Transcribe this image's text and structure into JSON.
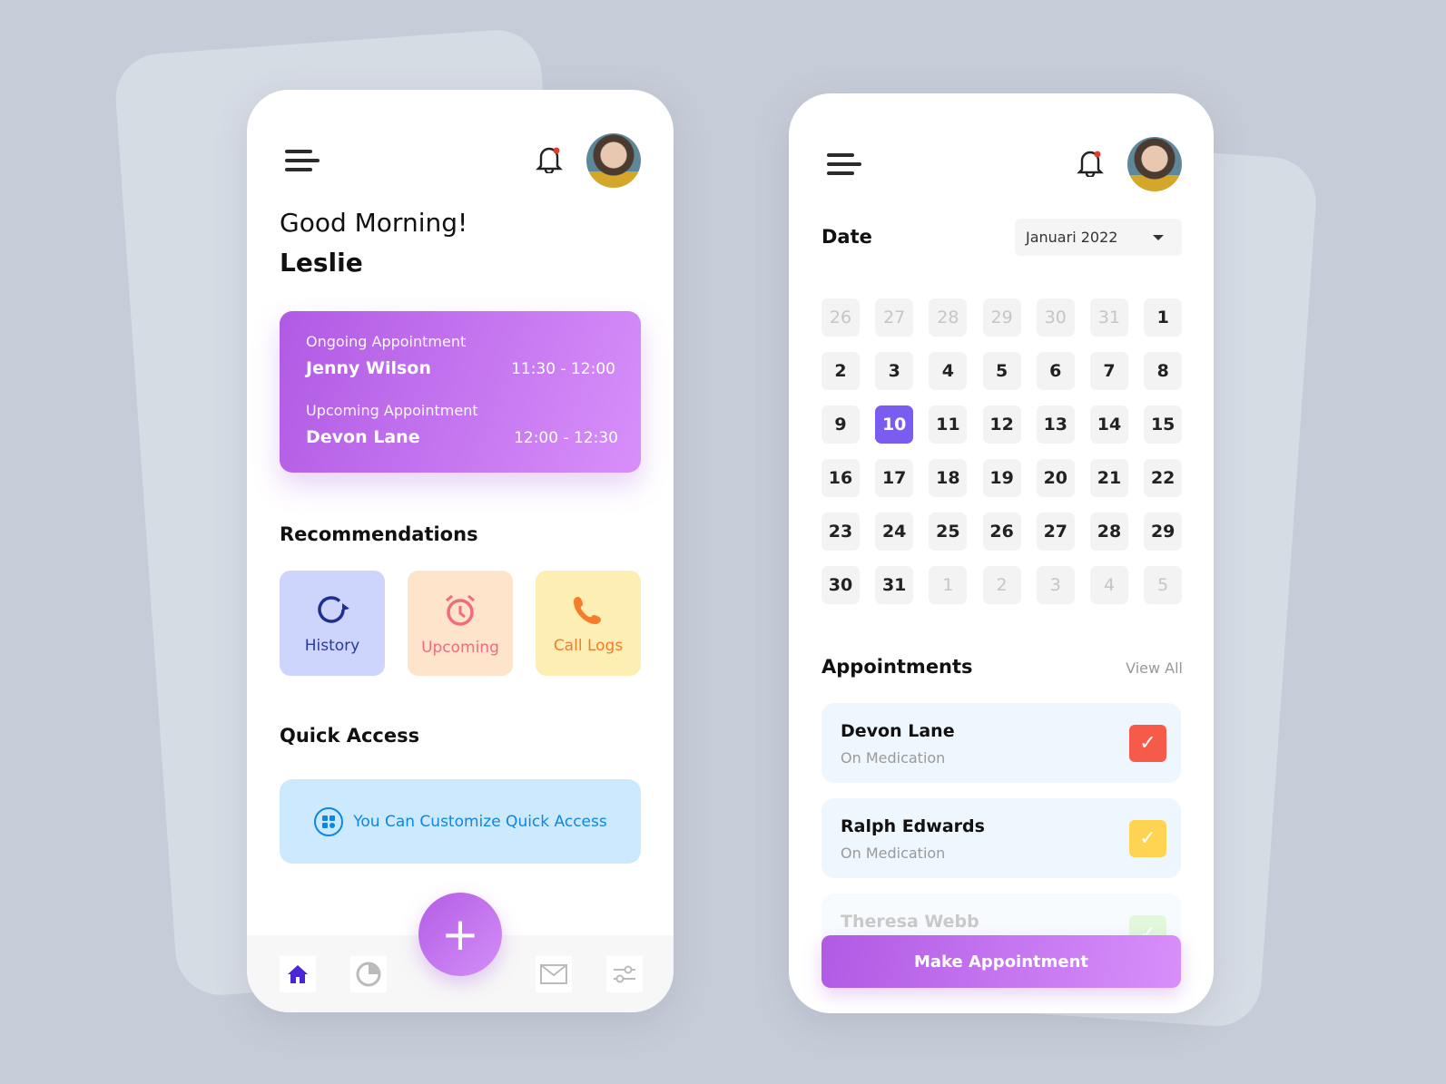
{
  "home": {
    "greeting": "Good Morning!",
    "user_name": "Leslie",
    "ongoing": {
      "label": "Ongoing Appointment",
      "name": "Jenny Wilson",
      "time": "11:30 - 12:00"
    },
    "upcoming": {
      "label": "Upcoming Appointment",
      "name": "Devon Lane",
      "time": "12:00 - 12:30"
    },
    "recommendations_title": "Recommendations",
    "recommendations": [
      {
        "label": "History",
        "icon": "refresh-icon",
        "bg": "#cdd5fd",
        "color": "#2a3a9a"
      },
      {
        "label": "Upcoming",
        "icon": "alarm-clock-icon",
        "bg": "#fde4cb",
        "color": "#f26a80"
      },
      {
        "label": "Call Logs",
        "icon": "phone-icon",
        "bg": "#fdefb4",
        "color": "#f57c2b"
      }
    ],
    "quick_access_title": "Quick Access",
    "quick_access_text": "You Can Customize Quick Access",
    "fab_label": "+",
    "nav": [
      "home-icon",
      "pie-chart-icon",
      "mail-icon",
      "sliders-icon"
    ]
  },
  "calendar": {
    "title": "Date",
    "month_select": "Januari 2022",
    "selected_day": "10",
    "days": [
      [
        "26",
        "27",
        "28",
        "29",
        "30",
        "31",
        "1"
      ],
      [
        "2",
        "3",
        "4",
        "5",
        "6",
        "7",
        "8"
      ],
      [
        "9",
        "10",
        "11",
        "12",
        "13",
        "14",
        "15"
      ],
      [
        "16",
        "17",
        "18",
        "19",
        "20",
        "21",
        "22"
      ],
      [
        "23",
        "24",
        "25",
        "26",
        "27",
        "28",
        "29"
      ],
      [
        "30",
        "31",
        "1",
        "2",
        "3",
        "4",
        "5"
      ]
    ],
    "appointments_title": "Appointments",
    "view_all": "View All",
    "appointments": [
      {
        "name": "Devon Lane",
        "status": "On Medication",
        "color": "#f65b4a"
      },
      {
        "name": "Ralph Edwards",
        "status": "On Medication",
        "color": "#fed452"
      },
      {
        "name": "Theresa Webb",
        "status": "",
        "color": "#bff0b0"
      }
    ],
    "cta": "Make Appointment"
  },
  "colors": {
    "accent": "#b45de4",
    "selected": "#7b5cf0"
  }
}
